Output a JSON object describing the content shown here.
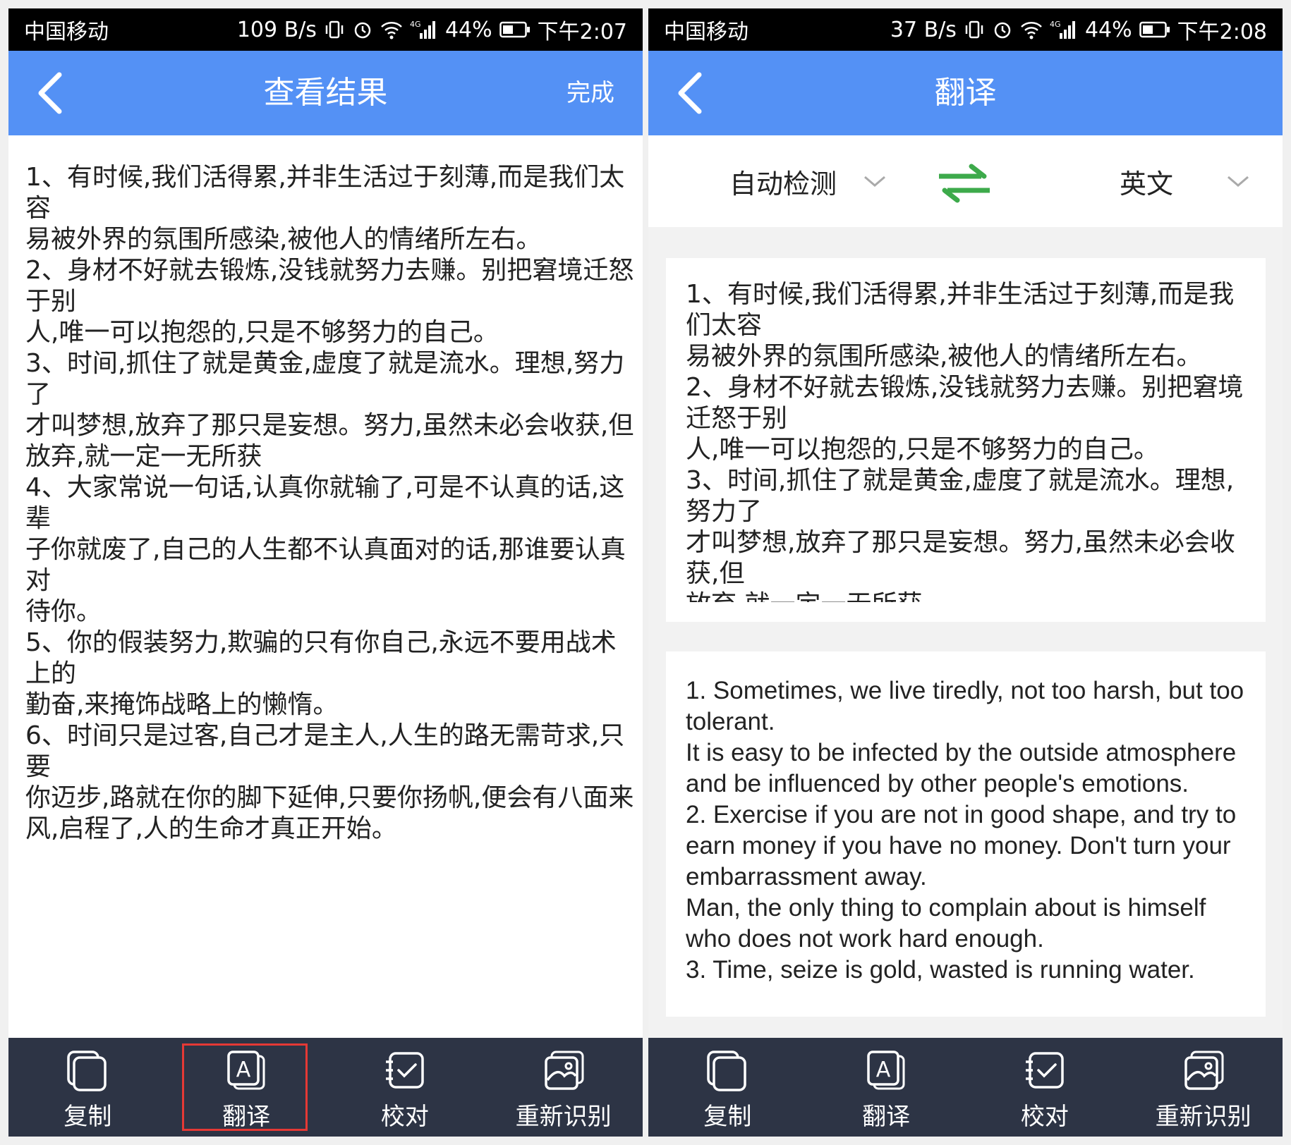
{
  "left_screen": {
    "status": {
      "carrier": "中国移动",
      "speed": "109 B/s",
      "network": "4G",
      "battery": "44%",
      "time": "下午2:07"
    },
    "nav": {
      "title": "查看结果",
      "done": "完成"
    },
    "ocr_text": "1、有时候,我们活得累,并非生活过于刻薄,而是我们太容\n易被外界的氛围所感染,被他人的情绪所左右。\n2、身材不好就去锻炼,没钱就努力去赚。别把窘境迁怒于别\n人,唯一可以抱怨的,只是不够努力的自己。\n3、时间,抓住了就是黄金,虚度了就是流水。理想,努力了\n才叫梦想,放弃了那只是妄想。努力,虽然未必会收获,但\n放弃,就一定一无所获\n4、大家常说一句话,认真你就输了,可是不认真的话,这辈\n子你就废了,自己的人生都不认真面对的话,那谁要认真对\n待你。\n5、你的假装努力,欺骗的只有你自己,永远不要用战术上的\n勤奋,来掩饰战略上的懒惰。\n6、时间只是过客,自己才是主人,人生的路无需苛求,只要\n你迈步,路就在你的脚下延伸,只要你扬帆,便会有八面来\n风,启程了,人的生命才真正开始。",
    "toolbar": [
      {
        "label": "复制",
        "icon": "copy-icon"
      },
      {
        "label": "翻译",
        "icon": "translate-icon",
        "highlighted": true
      },
      {
        "label": "校对",
        "icon": "proofread-icon"
      },
      {
        "label": "重新识别",
        "icon": "re-recognize-icon"
      }
    ]
  },
  "right_screen": {
    "status": {
      "carrier": "中国移动",
      "speed": "37 B/s",
      "network": "4G",
      "battery": "44%",
      "time": "下午2:08"
    },
    "nav": {
      "title": "翻译"
    },
    "languages": {
      "source": "自动检测",
      "target": "英文"
    },
    "source_text": "1、有时候,我们活得累,并非生活过于刻薄,而是我们太容\n易被外界的氛围所感染,被他人的情绪所左右。\n2、身材不好就去锻炼,没钱就努力去赚。别把窘境迁怒于别\n人,唯一可以抱怨的,只是不够努力的自己。\n3、时间,抓住了就是黄金,虚度了就是流水。理想,努力了\n才叫梦想,放弃了那只是妄想。努力,虽然未必会收获,但\n放弃,就一定一无所获",
    "translated_text": "1. Sometimes, we live tiredly, not too harsh, but too tolerant.\nIt is easy to be infected by the outside atmosphere and be influenced by other people's emotions.\n2. Exercise if you are not in good shape, and try to earn money if you have no money. Don't turn your embarrassment away.\nMan, the only thing to complain about is himself who does not work hard enough.\n3. Time, seize is gold, wasted is running water.",
    "toolbar": [
      {
        "label": "复制",
        "icon": "copy-icon"
      },
      {
        "label": "翻译",
        "icon": "translate-icon"
      },
      {
        "label": "校对",
        "icon": "proofread-icon"
      },
      {
        "label": "重新识别",
        "icon": "re-recognize-icon"
      }
    ]
  },
  "colors": {
    "nav_blue": "#5491f5",
    "toolbar_dark": "#2d3445",
    "swap_green": "#3daa4b",
    "highlight_red": "#e53935"
  }
}
